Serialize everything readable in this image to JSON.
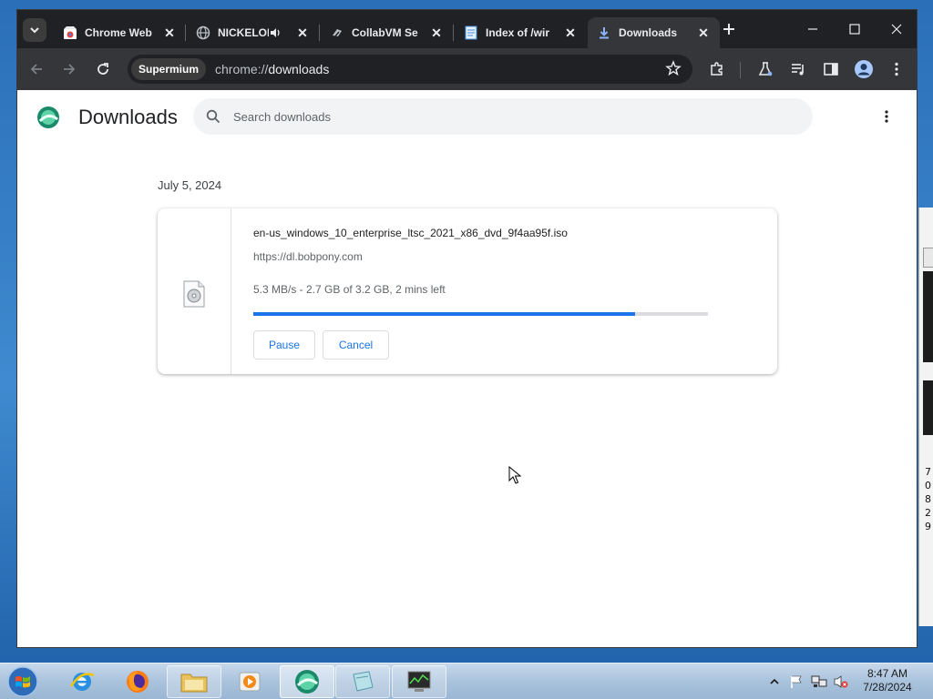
{
  "tabs": [
    {
      "title": "Chrome Web",
      "active": false
    },
    {
      "title": "NICKELOD",
      "active": false,
      "audio": true
    },
    {
      "title": "CollabVM Se",
      "active": false
    },
    {
      "title": "Index of /wir",
      "active": false
    },
    {
      "title": "Downloads",
      "active": true
    }
  ],
  "toolbar": {
    "browser_chip": "Supermium",
    "url_scheme": "chrome://",
    "url_host": "downloads"
  },
  "page": {
    "title": "Downloads",
    "search_placeholder": "Search downloads",
    "date_heading": "July 5, 2024",
    "download": {
      "filename": "en-us_windows_10_enterprise_ltsc_2021_x86_dvd_9f4aa95f.iso",
      "source": "https://dl.bobpony.com",
      "status": "5.3 MB/s - 2.7 GB of 3.2 GB, 2 mins left",
      "progress_percent": 84,
      "pause_label": "Pause",
      "cancel_label": "Cancel"
    }
  },
  "desktop_text": {
    "right_edge_chars": [
      "7",
      "0",
      "8",
      "2",
      "9"
    ]
  },
  "taskbar": {
    "time": "8:47 AM",
    "date": "7/28/2024"
  },
  "colors": {
    "accent": "#1a73e8",
    "frame": "#202124",
    "toolbar": "#35363a"
  }
}
